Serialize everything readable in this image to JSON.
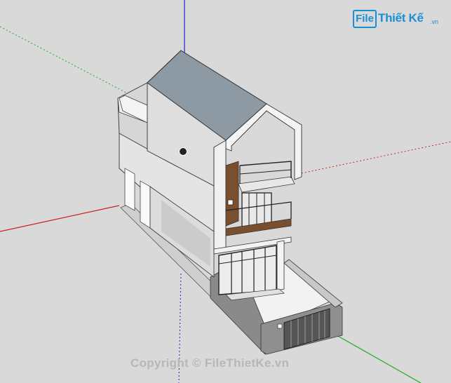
{
  "logo": {
    "box_text": "File",
    "main_text": "Thiết Kế",
    "sub_text": ".vn"
  },
  "watermark": {
    "text": "Copyright © FileThietKe.vn"
  },
  "colors": {
    "background": "#d9d9d9",
    "axis_red": "#cc2222",
    "axis_green": "#22aa22",
    "axis_blue": "#2222cc",
    "wall": "#e8e8e8",
    "wall_shadow": "#bdbdbd",
    "roof": "#8e9aa3",
    "wood": "#7a4f2e",
    "logo_blue": "#1a8fd6"
  },
  "icons": {
    "orbit_cursor": "orbit-pivot-icon"
  }
}
